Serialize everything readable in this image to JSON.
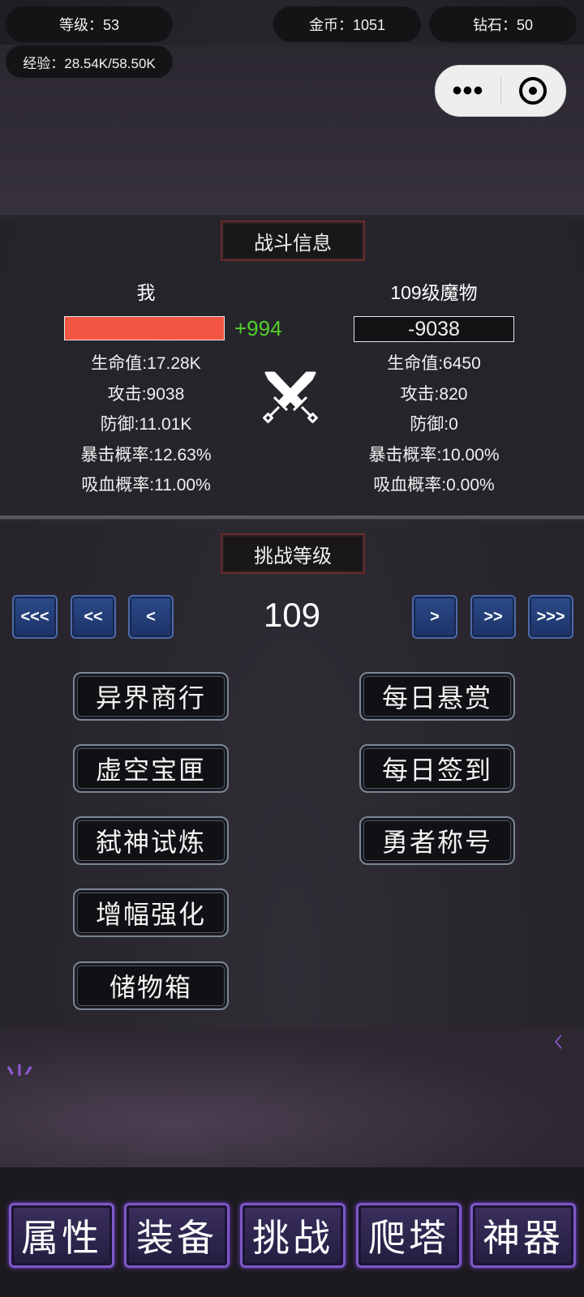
{
  "status": {
    "level_label": "等级：53",
    "gold_label": "金币：1051",
    "diamond_label": "钻石：50",
    "exp_label": "经验：28.54K/58.50K"
  },
  "capsule": {
    "more_glyph": "•••"
  },
  "battle": {
    "title": "战斗信息",
    "player": {
      "name": "我",
      "hp_change": "+994",
      "hp_fraction": 1.0,
      "hp_bar_color": "#f25541",
      "stats": [
        "生命值:17.28K",
        "攻击:9038",
        "防御:11.01K",
        "暴击概率:12.63%",
        "吸血概率:11.00%"
      ]
    },
    "enemy": {
      "name": "109级魔物",
      "hp_text": "-9038",
      "stats": [
        "生命值:6450",
        "攻击:820",
        "防御:0",
        "暴击概率:10.00%",
        "吸血概率:0.00%"
      ]
    },
    "vs_icon": "crossed-swords-icon"
  },
  "challenge": {
    "title": "挑战等级",
    "level": "109",
    "nav": {
      "first": "<<<",
      "prev10": "<<",
      "prev": "<",
      "next": ">",
      "next10": ">>",
      "last": ">>>"
    }
  },
  "menu": {
    "left": [
      "异界商行",
      "虚空宝匣",
      "弑神试炼",
      "增幅强化",
      "储物箱"
    ],
    "right": [
      "每日悬赏",
      "每日签到",
      "勇者称号"
    ]
  },
  "tabs": [
    "属性",
    "装备",
    "挑战",
    "爬塔",
    "神器"
  ],
  "colors": {
    "accent_green": "#52d12b",
    "hp_red": "#f25541",
    "tab_border": "#7e58c9",
    "nav_blue": "#2c4a8a"
  }
}
